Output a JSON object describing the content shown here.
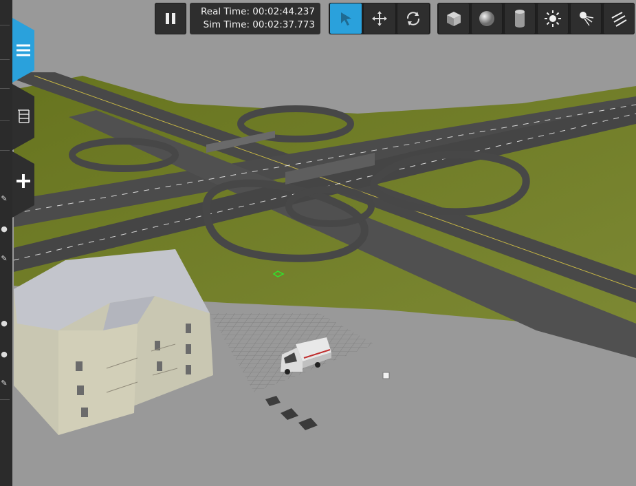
{
  "toolbar": {
    "pause_icon": "pause-icon",
    "real_time_label": "Real Time:",
    "real_time_value": "00:02:44.237",
    "sim_time_label": "Sim Time:",
    "sim_time_value": "00:02:37.773",
    "modes": [
      {
        "name": "select",
        "icon": "arrow-cursor-icon",
        "active": true
      },
      {
        "name": "translate",
        "icon": "move-arrows-icon",
        "active": false
      },
      {
        "name": "rotate",
        "icon": "rotate-icon",
        "active": false
      }
    ],
    "shapes": [
      {
        "name": "box",
        "icon": "cube-icon"
      },
      {
        "name": "sphere",
        "icon": "sphere-icon"
      },
      {
        "name": "cylinder",
        "icon": "cylinder-icon"
      },
      {
        "name": "point-light",
        "icon": "sun-icon"
      },
      {
        "name": "spot-light",
        "icon": "spotlight-icon"
      },
      {
        "name": "directional-light",
        "icon": "directional-light-icon"
      }
    ]
  },
  "side_tabs": [
    {
      "name": "menu",
      "icon": "hamburger-icon",
      "active": true
    },
    {
      "name": "model-tree",
      "icon": "tree-icon",
      "active": false
    },
    {
      "name": "insert",
      "icon": "plus-icon",
      "active": false
    }
  ],
  "colors": {
    "accent": "#2aa1dc",
    "toolbar_bg": "#2e2e2e",
    "sky": "#9a9a9a",
    "grass": "#6f7d2a",
    "road": "#4a4a4a"
  }
}
